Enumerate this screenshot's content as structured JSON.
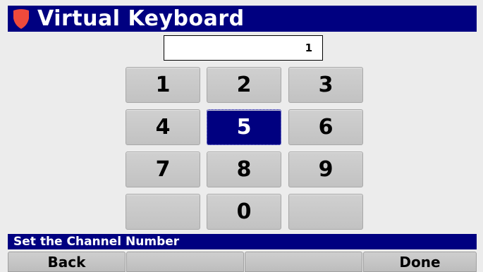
{
  "header": {
    "title": "Virtual Keyboard",
    "icon": "shield-icon",
    "background": "#000080",
    "icon_color": "#ef4a3c"
  },
  "entry": {
    "value": "1"
  },
  "keypad": {
    "keys": [
      "1",
      "2",
      "3",
      "4",
      "5",
      "6",
      "7",
      "8",
      "9",
      "",
      "0",
      ""
    ],
    "selected_key": "5",
    "selected_color": "#000080"
  },
  "status": {
    "text": "Set the Channel Number"
  },
  "softkeys": {
    "back": "Back",
    "f2": "",
    "f3": "",
    "done": "Done"
  }
}
